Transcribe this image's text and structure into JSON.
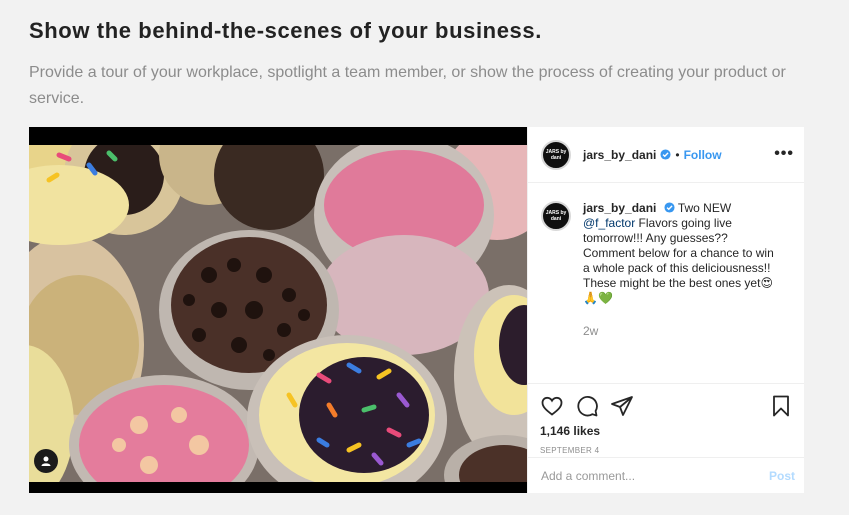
{
  "heading": "Show the behind-the-scenes of your business.",
  "subtext": "Provide a tour of your workplace, spotlight a team member, or show the process of creating your product or service.",
  "post": {
    "username": "jars_by_dani",
    "avatar_text": "JARS by dani",
    "follow_label": "Follow",
    "dot": "•",
    "more_label": "•••",
    "caption_username": "jars_by_dani",
    "caption_lead": "Two NEW ",
    "caption_mention": "@f_factor",
    "caption_rest": " Flavors going live tomorrow!!! Any guesses?? Comment below for a chance to win a whole pack of this deliciousness!! These might be the best ones yet😍🙏💚",
    "time_ago": "2w",
    "likes": "1,146 likes",
    "date": "SEPTEMBER 4",
    "comment_placeholder": "Add a comment...",
    "post_label": "Post",
    "icons": [
      "heart-icon",
      "comment-icon",
      "share-icon",
      "bookmark-icon",
      "verified-badge-icon",
      "user-tag-icon"
    ]
  },
  "colors": {
    "accent": "#3897f0",
    "post_disabled": "#b3dbff",
    "muted": "#8e8e8e"
  }
}
